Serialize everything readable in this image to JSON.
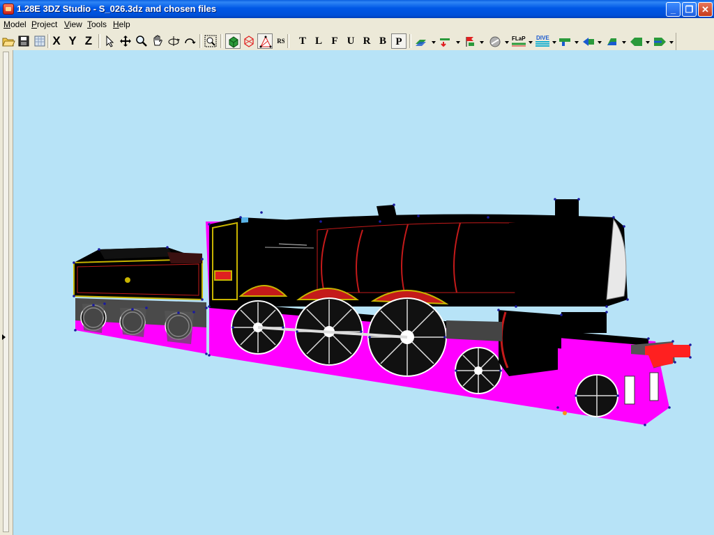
{
  "window": {
    "title": "1.28E 3DZ Studio - S_026.3dz and chosen files",
    "minimize": "_",
    "maximize": "❐",
    "close": "✕"
  },
  "menu": [
    {
      "label": "Model",
      "ul": "M",
      "rest": "odel"
    },
    {
      "label": "Project",
      "ul": "P",
      "rest": "roject"
    },
    {
      "label": "View",
      "ul": "V",
      "rest": "iew"
    },
    {
      "label": "Tools",
      "ul": "T",
      "rest": "ools"
    },
    {
      "label": "Help",
      "ul": "H",
      "rest": "elp"
    }
  ],
  "toolbar": {
    "axis_x": "X",
    "axis_y": "Y",
    "axis_z": "Z",
    "rs_label": "RS",
    "views": [
      "T",
      "L",
      "F",
      "U",
      "R",
      "B",
      "P"
    ],
    "active_view": "P"
  },
  "colors": {
    "viewport_bg": "#b7e3f7",
    "model_magenta": "#ff00ff",
    "model_black": "#000000",
    "vertex_blue": "#1a1aa0",
    "lining_red": "#c41a1a",
    "lining_yellow": "#c8b400"
  },
  "icons": {
    "toolbar1": [
      "open-folder-icon",
      "save-icon",
      "grid-icon",
      "select-arrow-icon",
      "move-icon",
      "zoom-icon",
      "pan-hand-icon",
      "rotate-icon",
      "orbit-icon",
      "zoom-extents-icon",
      "solid-view-icon",
      "wireframe-icon",
      "vertex-view-icon"
    ],
    "toolbar2": [
      "black-paint-icon",
      "red-paint-icon",
      "yellow-paint-icon",
      "paint-tool-icon",
      "texture-tool-icon",
      "flap-icon",
      "dive-icon"
    ]
  }
}
